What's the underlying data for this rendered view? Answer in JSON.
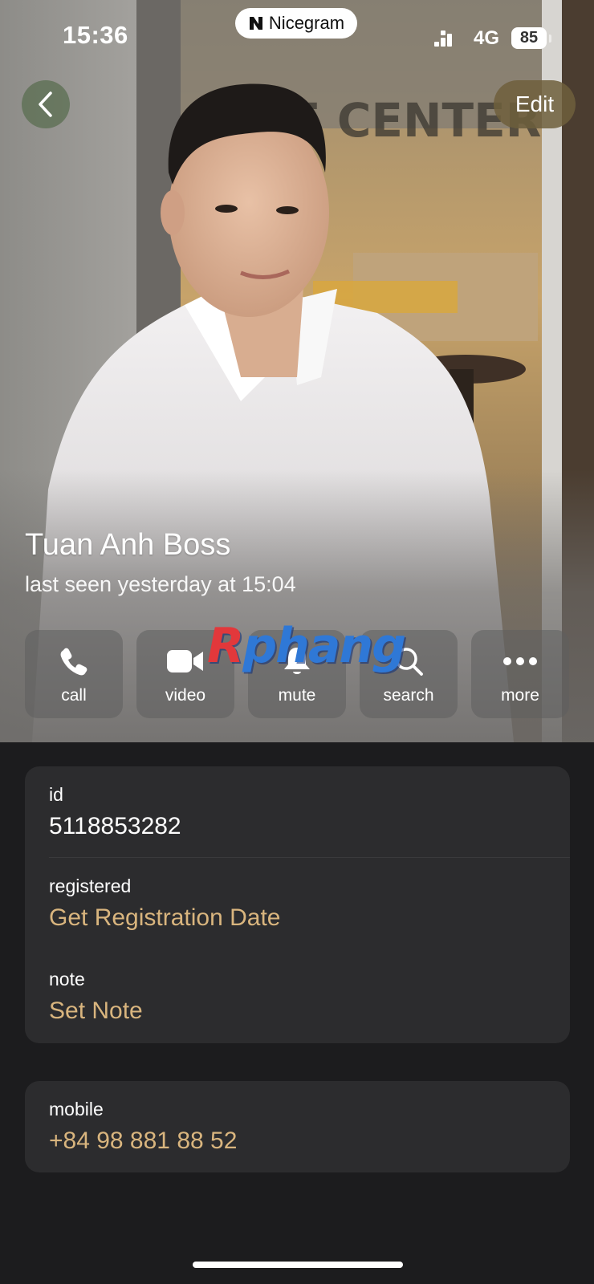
{
  "status_bar": {
    "time": "15:36",
    "app_name": "Nicegram",
    "network": "4G",
    "battery": "85"
  },
  "nav": {
    "back_icon": "chevron-left-icon",
    "edit_label": "Edit"
  },
  "profile": {
    "name": "Tuan Anh Boss",
    "last_seen": "last seen yesterday at 15:04"
  },
  "actions": [
    {
      "label": "call",
      "icon": "phone-icon"
    },
    {
      "label": "video",
      "icon": "video-camera-icon"
    },
    {
      "label": "mute",
      "icon": "bell-icon"
    },
    {
      "label": "search",
      "icon": "search-icon"
    },
    {
      "label": "more",
      "icon": "more-dots-icon"
    }
  ],
  "watermark": {
    "first": "R",
    "rest": "phang"
  },
  "info": {
    "id_caption": "id",
    "id_value": "5118853282",
    "registered_caption": "registered",
    "registered_value": "Get Registration Date",
    "note_caption": "note",
    "note_value": "Set Note"
  },
  "contact": {
    "mobile_caption": "mobile",
    "mobile_value": "+84 98 881 88 52"
  },
  "colors": {
    "accent": "#d9b57e",
    "background": "#1c1c1e",
    "card": "#2c2c2e"
  }
}
